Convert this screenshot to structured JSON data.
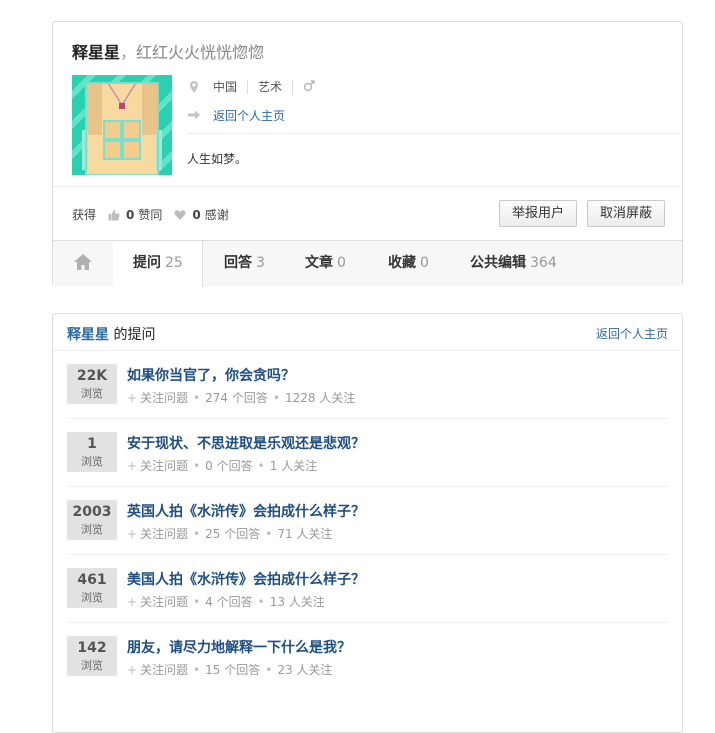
{
  "profile": {
    "name": "释星星",
    "separator": "，",
    "tagline": "红红火火恍恍惚惚",
    "location": "中国",
    "field": "艺术",
    "gender_icon": "male-icon",
    "home_link": "返回个人主页",
    "bio": "人生如梦。",
    "stats": {
      "prefix": "获得",
      "agree_count": "0",
      "agree_label": "赞同",
      "thanks_count": "0",
      "thanks_label": "感谢"
    },
    "report_button": "举报用户",
    "unblock_button": "取消屏蔽"
  },
  "tabs": [
    {
      "label": "提问",
      "count": "25"
    },
    {
      "label": "回答",
      "count": "3"
    },
    {
      "label": "文章",
      "count": "0"
    },
    {
      "label": "收藏",
      "count": "0"
    },
    {
      "label": "公共编辑",
      "count": "364"
    }
  ],
  "questions": {
    "owner": "释星星",
    "header_suffix": "的提问",
    "back_link": "返回个人主页",
    "items": [
      {
        "views": "22K",
        "views_label": "浏览",
        "title": "如果你当官了，你会贪吗？",
        "follow": "关注问题",
        "answers": "274 个回答",
        "followers": "1228 人关注"
      },
      {
        "views": "1",
        "views_label": "浏览",
        "title": "安于现状、不思进取是乐观还是悲观？",
        "follow": "关注问题",
        "answers": "0 个回答",
        "followers": "1 人关注"
      },
      {
        "views": "2003",
        "views_label": "浏览",
        "title": "英国人拍《水浒传》会拍成什么样子？",
        "follow": "关注问题",
        "answers": "25 个回答",
        "followers": "71 人关注"
      },
      {
        "views": "461",
        "views_label": "浏览",
        "title": "美国人拍《水浒传》会拍成什么样子？",
        "follow": "关注问题",
        "answers": "4 个回答",
        "followers": "13 人关注"
      },
      {
        "views": "142",
        "views_label": "浏览",
        "title": "朋友，请尽力地解释一下什么是我？",
        "follow": "关注问题",
        "answers": "15 个回答",
        "followers": "23 人关注"
      }
    ]
  }
}
